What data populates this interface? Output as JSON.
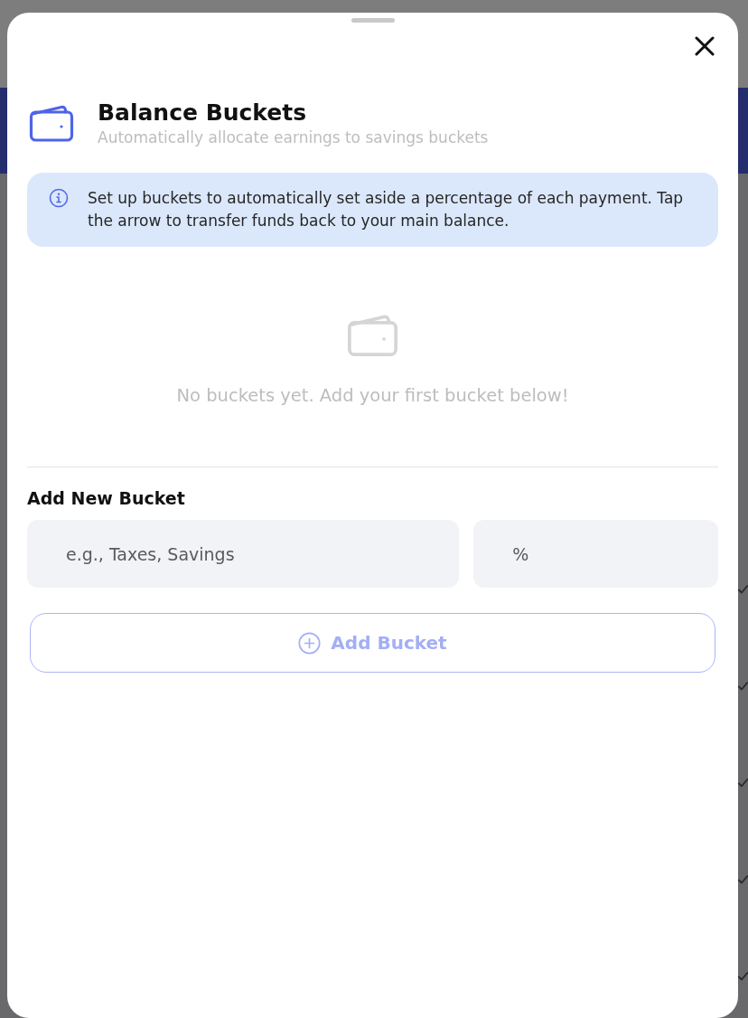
{
  "sheet": {
    "title": "Balance Buckets",
    "subtitle": "Automatically allocate earnings to savings buckets"
  },
  "info": {
    "text": "Set up buckets to automatically set aside a percentage of each payment. Tap the arrow to transfer funds back to your main balance."
  },
  "empty_state": {
    "text": "No buckets yet. Add your first bucket below!"
  },
  "add_form": {
    "heading": "Add New Bucket",
    "name_field": {
      "placeholder": "e.g., Taxes, Savings"
    },
    "percent_field": {
      "placeholder": "%"
    },
    "button": {
      "label": "Add Bucket",
      "disabled": true
    }
  }
}
